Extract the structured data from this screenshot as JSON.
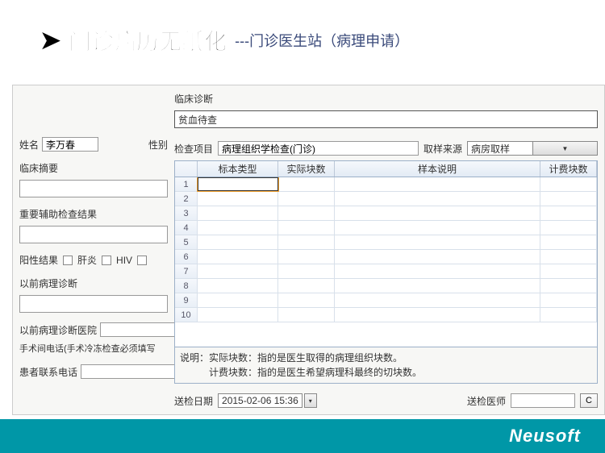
{
  "header": {
    "arrow": "➤",
    "title_main": "门诊病历无纸化",
    "title_sub": "---门诊医生站（病理申请）"
  },
  "form": {
    "name_label": "姓名",
    "name_value": "李万春",
    "gender_label": "性别",
    "summary_label": "临床摘要",
    "summary_value": "",
    "aux_label": "重要辅助检查结果",
    "aux_value": "",
    "positive_label": "阳性结果",
    "hepatitis": "肝炎",
    "hiv": "HIV",
    "prev_path_label": "以前病理诊断",
    "prev_path_value": "",
    "prev_hosp_label": "以前病理诊断医院",
    "prev_hosp_value": "",
    "surgery_phone_label": "手术间电话(手术冷冻检查必须填写",
    "patient_phone_label": "患者联系电话",
    "patient_phone_value": ""
  },
  "right": {
    "clinical_diag_label": "临床诊断",
    "clinical_diag_value": "贫血待查",
    "exam_item_label": "检查项目",
    "exam_item_value": "病理组织学检查(门诊)",
    "sample_source_label": "取样来源",
    "sample_source_value": "病房取样"
  },
  "grid": {
    "headers": {
      "row": "",
      "type": "标本类型",
      "actual": "实际块数",
      "desc": "样本说明",
      "bill": "计费块数"
    },
    "rows": [
      1,
      2,
      3,
      4,
      5,
      6,
      7,
      8,
      9,
      10
    ],
    "note_line1": "说明：实际块数：指的是医生取得的病理组织块数。",
    "note_line2": "计费块数：指的是医生希望病理科最终的切块数。"
  },
  "bottom": {
    "send_date_label": "送检日期",
    "send_date_value": "2015-02-06 15:36",
    "send_doctor_label": "送检医师",
    "send_doctor_value": "",
    "c_btn": "C"
  },
  "footer": {
    "logo": "Neusoft"
  }
}
